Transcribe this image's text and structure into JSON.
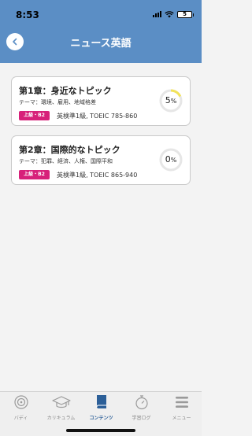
{
  "status_bar": {
    "time": "8:53",
    "battery": "5"
  },
  "header": {
    "title": "ニュース英語"
  },
  "chapters": [
    {
      "title": "第1章：身近なトピック",
      "theme": "テーマ：環境、雇用、地域格差",
      "badge": "上級・B2",
      "level": "英検準1級, TOEIC 785-860",
      "progress_value": "5",
      "progress_unit": "%"
    },
    {
      "title": "第2章：国際的なトピック",
      "theme": "テーマ：犯罪、経済、人権、国際平和",
      "badge": "上級・B2",
      "level": "英検準1級, TOEIC 865-940",
      "progress_value": "0",
      "progress_unit": "%"
    }
  ],
  "tabs": [
    {
      "label": "バディ",
      "icon": "buddy-icon"
    },
    {
      "label": "カリキュラム",
      "icon": "graduation-cap-icon"
    },
    {
      "label": "コンテンツ",
      "icon": "book-icon"
    },
    {
      "label": "学習ログ",
      "icon": "stopwatch-icon"
    },
    {
      "label": "メニュー",
      "icon": "menu-icon"
    }
  ],
  "colors": {
    "header": "#5b8ec5",
    "badge": "#d7217a",
    "progress": "#f2e35a",
    "active_tab": "#2c5f98"
  }
}
